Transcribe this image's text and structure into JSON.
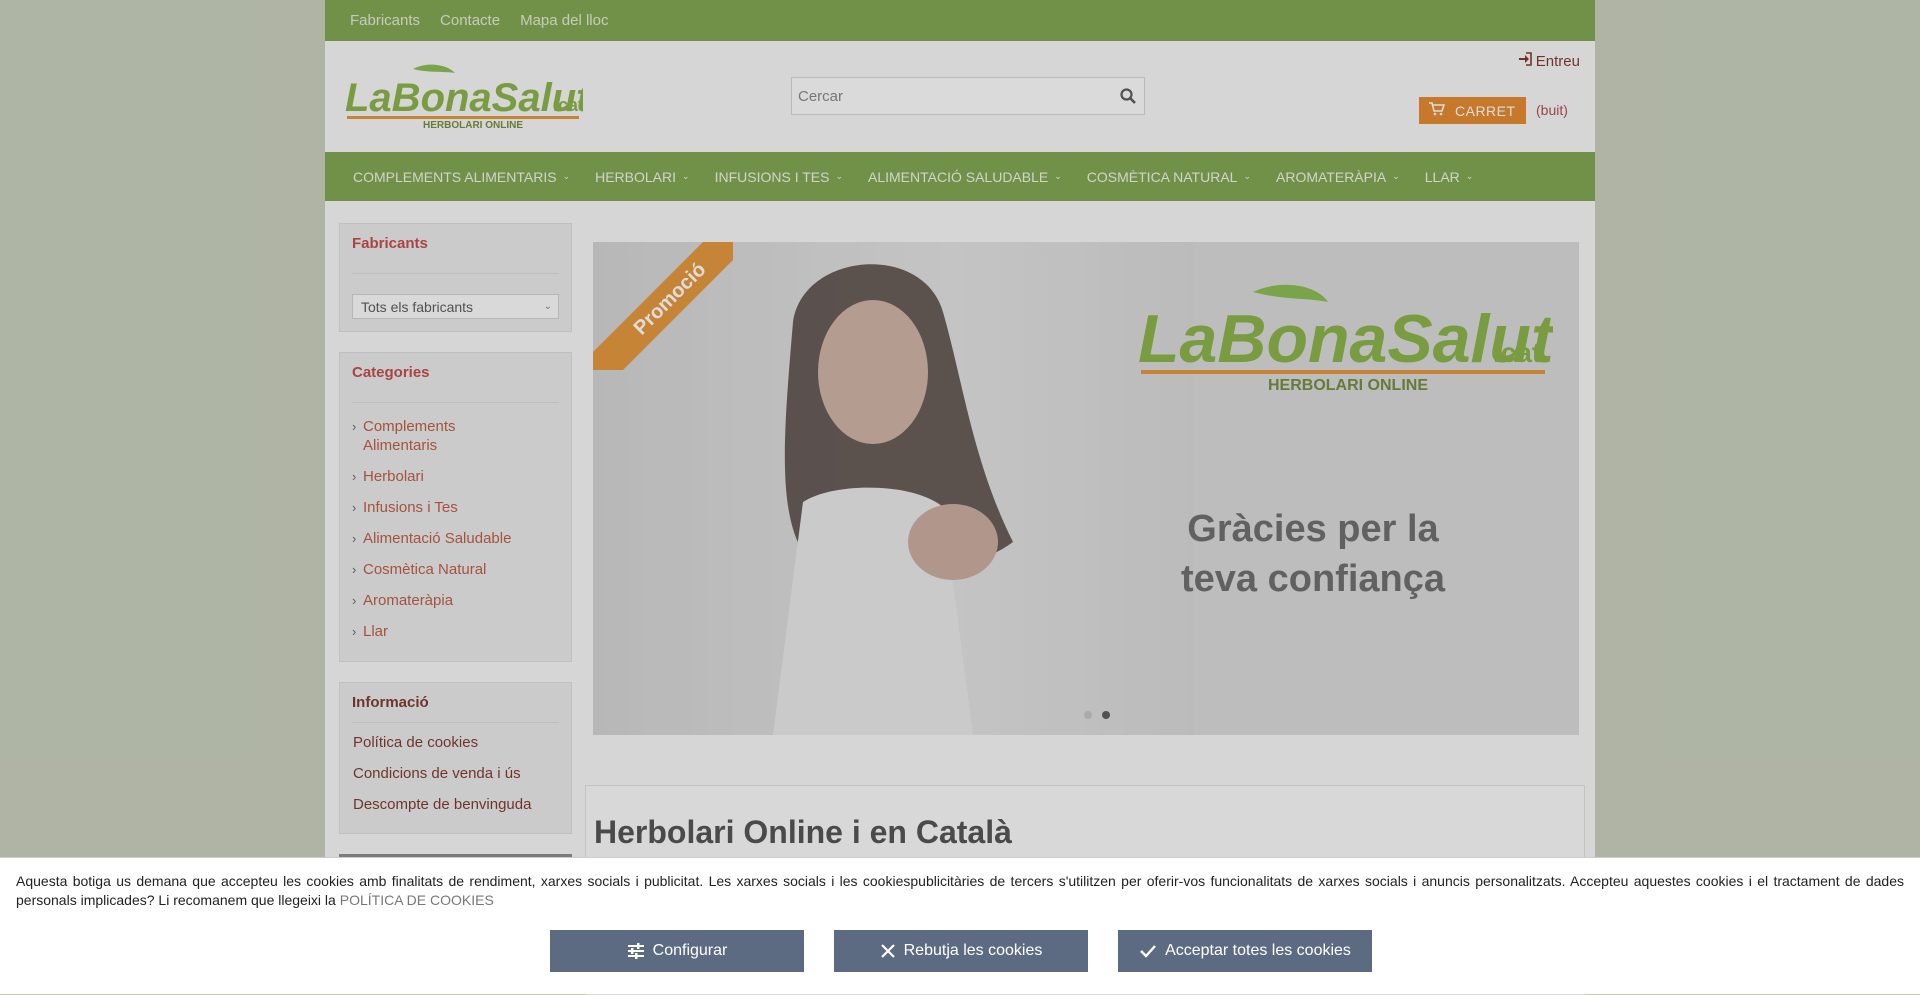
{
  "topbar": {
    "links": [
      "Fabricants",
      "Contacte",
      "Mapa del lloc"
    ]
  },
  "header": {
    "logo_text": "LaBonaSalut.cat",
    "logo_sub": "HERBOLARI ONLINE",
    "search_placeholder": "Cercar",
    "login_label": "Entreu",
    "cart_label": "CARRET",
    "cart_status": "(buit)"
  },
  "nav": {
    "items": [
      "COMPLEMENTS ALIMENTARIS",
      "HERBOLARI",
      "INFUSIONS I TES",
      "ALIMENTACIÓ SALUDABLE",
      "COSMÈTICA NATURAL",
      "AROMATERÀPIA",
      "LLAR"
    ]
  },
  "sidebar": {
    "manufacturers_title": "Fabricants",
    "manufacturers_select": "Tots els fabricants",
    "categories_title": "Categories",
    "categories": [
      "Complements Alimentaris",
      "Herbolari",
      "Infusions i Tes",
      "Alimentació Saludable",
      "Cosmètica Natural",
      "Aromateràpia",
      "Llar"
    ],
    "info_title": "Informació",
    "info_links": [
      "Política de cookies",
      "Condicions de venda i ús",
      "Descompte de benvinguda"
    ]
  },
  "slider": {
    "ribbon": "Promoció",
    "logo_text": "LaBonaSalut.cat",
    "logo_sub": "HERBOLARI ONLINE",
    "line1": "Gràcies per la",
    "line2": "teva confiança",
    "active_dot": 2
  },
  "content": {
    "title": "Herbolari Online i en Català"
  },
  "cookie": {
    "text": "Aquesta botiga us demana que accepteu les cookies amb finalitats de rendiment, xarxes socials i publicitat. Les xarxes socials i les cookiespublicitàries de tercers s'utilitzen per oferir-vos funcionalitats de xarxes socials i anuncis personalitzats. Accepteu aquestes cookies i el tractament de dades personals implicades? Li recomanem que llegeixi la",
    "link": "POLÍTICA DE COOKIES",
    "btn_configure": "Configurar",
    "btn_reject": "Rebutja les cookies",
    "btn_accept": "Acceptar totes les cookies"
  }
}
